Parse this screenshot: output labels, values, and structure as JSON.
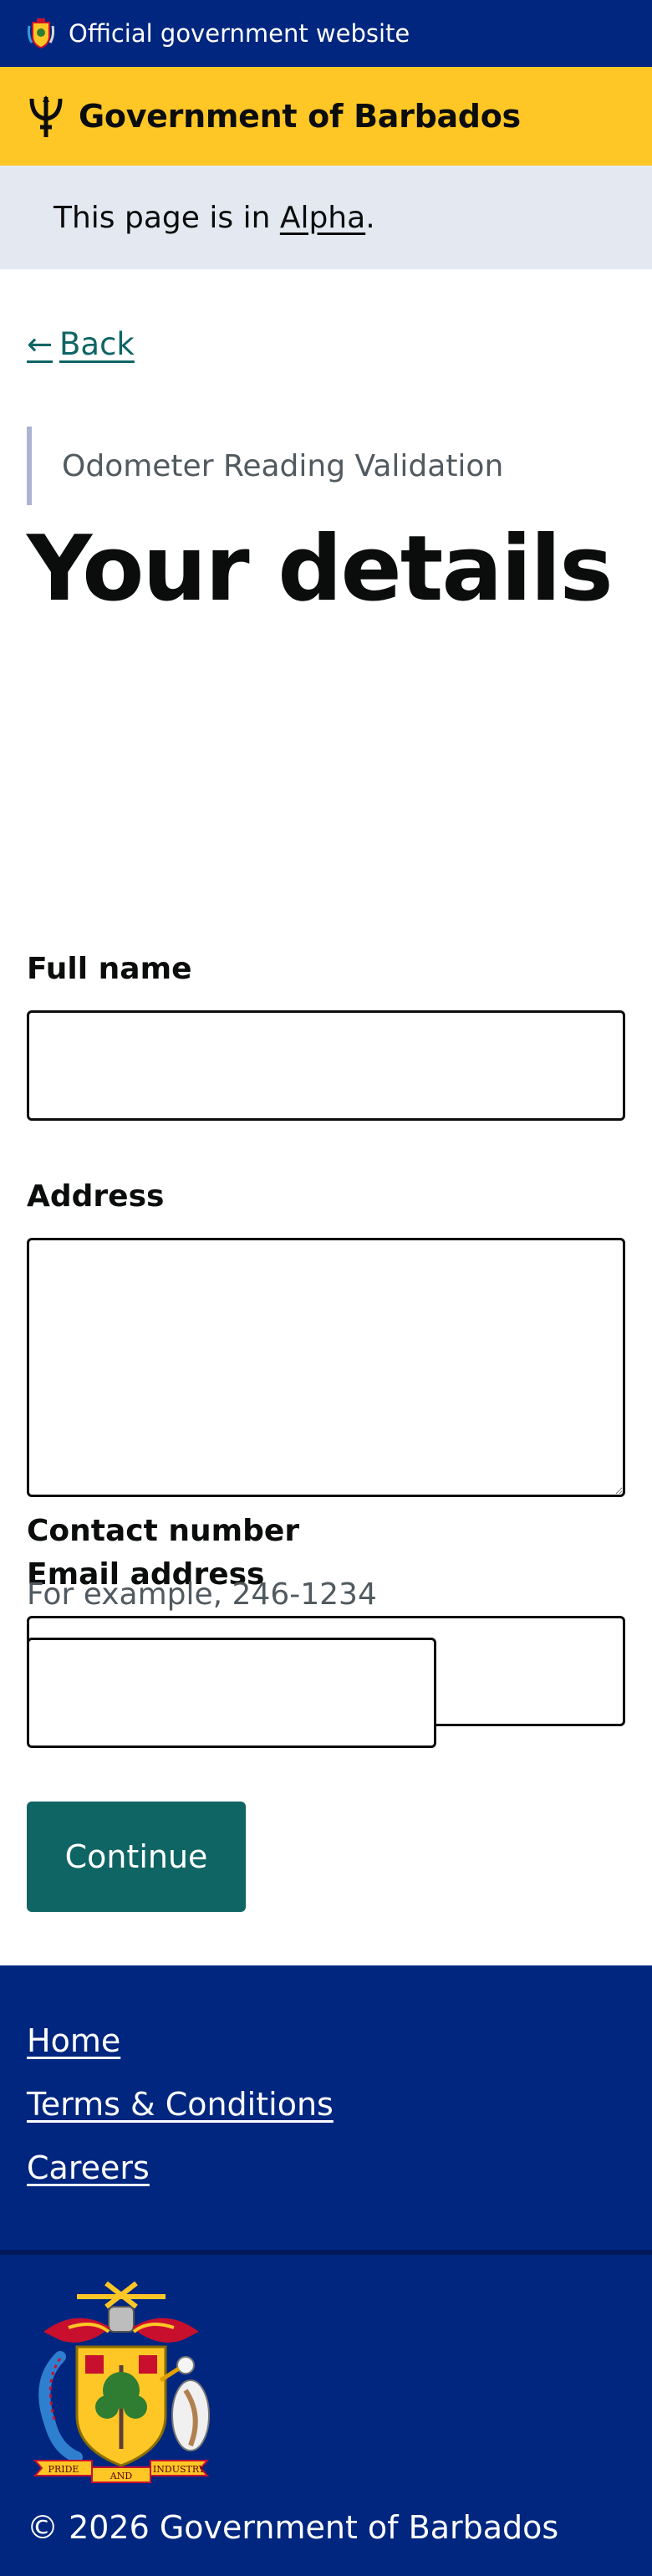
{
  "topbar": {
    "text": "Official government website"
  },
  "header": {
    "title": "Government of Barbados"
  },
  "phase": {
    "prefix": "This page is in ",
    "link": "Alpha",
    "suffix": "."
  },
  "back": {
    "arrow": "←",
    "label": "Back"
  },
  "caption": "Odometer Reading Validation",
  "title": "Your details",
  "fields": {
    "full_name": {
      "label": "Full name",
      "value": ""
    },
    "address": {
      "label": "Address",
      "value": ""
    },
    "email": {
      "label": "Email address",
      "value": ""
    },
    "contact": {
      "label": "Contact number",
      "hint": "For example, 246-1234",
      "value": ""
    }
  },
  "continue_label": "Continue",
  "footer": {
    "links": [
      "Home",
      "Terms & Conditions",
      "Careers"
    ],
    "motto_left": "PRIDE",
    "motto_middle": "AND",
    "motto_right": "INDUSTRY",
    "copyright": "© 2026 Government of Barbados"
  },
  "colors": {
    "navy": "#00267f",
    "gold": "#ffc726",
    "teal": "#0f6564",
    "phase_bg": "#e4e9f1"
  }
}
